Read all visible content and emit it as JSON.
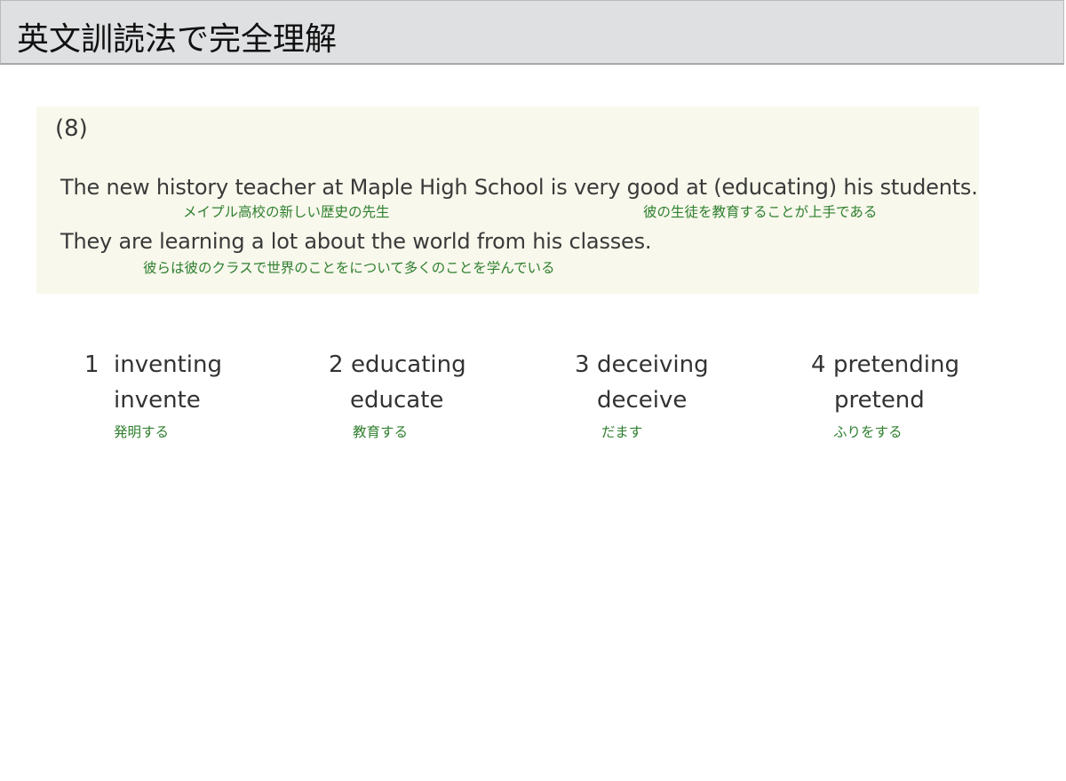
{
  "header": {
    "title": "英文訓読法で完全理解"
  },
  "problem": {
    "number": "(8)",
    "sentence1": {
      "before": "The new history teacher at Maple High School is very good at (",
      "answer": "educating",
      "after": ") his students."
    },
    "gloss1a": "メイプル高校の新しい歴史の先生",
    "gloss1b": "彼の生徒を教育することが上手である",
    "sentence2": "They are learning a lot about the world from his classes.",
    "gloss2": "彼らは彼のクラスで世界のことをについて多くのことを学んでいる"
  },
  "choices": [
    {
      "number": "1",
      "word": "inventing",
      "base": "invente",
      "meaning": "発明する"
    },
    {
      "number": "2",
      "word": "educating",
      "base": "educate",
      "meaning": "教育する"
    },
    {
      "number": "3",
      "word": "deceiving",
      "base": "deceive",
      "meaning": "だます"
    },
    {
      "number": "4",
      "word": "pretending",
      "base": "pretend",
      "meaning": "ふりをする"
    }
  ]
}
